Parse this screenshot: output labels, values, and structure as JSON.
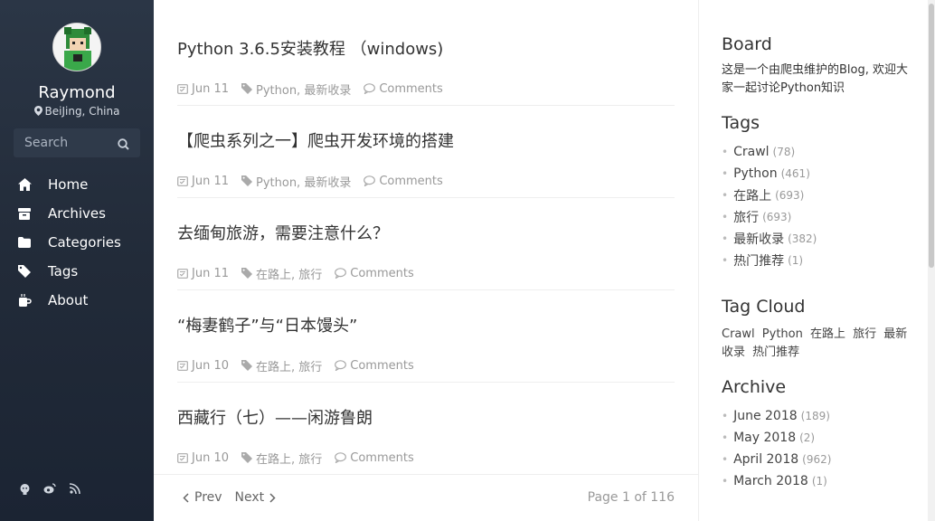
{
  "sidebar": {
    "author": "Raymond",
    "location": "BeiJing, China",
    "search_placeholder": "Search",
    "nav": [
      {
        "label": "Home",
        "icon": "home-icon"
      },
      {
        "label": "Archives",
        "icon": "archive-icon"
      },
      {
        "label": "Categories",
        "icon": "folder-icon"
      },
      {
        "label": "Tags",
        "icon": "tag-icon"
      },
      {
        "label": "About",
        "icon": "coffee-icon"
      }
    ],
    "social": [
      "github-icon",
      "weibo-icon",
      "rss-icon"
    ]
  },
  "posts": [
    {
      "title": "Python 3.6.5安装教程 （windows)",
      "date": "Jun 11",
      "tags": "Python, 最新收录",
      "comments": "Comments"
    },
    {
      "title": "【爬虫系列之一】爬虫开发环境的搭建",
      "date": "Jun 11",
      "tags": "Python, 最新收录",
      "comments": "Comments"
    },
    {
      "title": "去缅甸旅游，需要注意什么？",
      "date": "Jun 11",
      "tags": "在路上, 旅行",
      "comments": "Comments"
    },
    {
      "title": "“梅妻鹤子”与“日本馒头”",
      "date": "Jun 10",
      "tags": "在路上, 旅行",
      "comments": "Comments"
    },
    {
      "title": "西藏行（七）——闲游鲁朗",
      "date": "Jun 10",
      "tags": "在路上, 旅行",
      "comments": "Comments"
    }
  ],
  "pager": {
    "prev": "Prev",
    "next": "Next",
    "page_info": "Page 1 of 116"
  },
  "right": {
    "board_title": "Board",
    "board_text": "这是一个由爬虫维护的Blog, 欢迎大家一起讨论Python知识",
    "tags_title": "Tags",
    "tags": [
      {
        "name": "Crawl",
        "count": "(78)"
      },
      {
        "name": "Python",
        "count": "(461)"
      },
      {
        "name": "在路上",
        "count": "(693)"
      },
      {
        "name": "旅行",
        "count": "(693)"
      },
      {
        "name": "最新收录",
        "count": "(382)"
      },
      {
        "name": "热门推荐",
        "count": "(1)"
      }
    ],
    "cloud_title": "Tag Cloud",
    "cloud": [
      "Crawl",
      "Python",
      "在路上",
      "旅行",
      "最新收录",
      "热门推荐"
    ],
    "archive_title": "Archive",
    "archive": [
      {
        "name": "June 2018",
        "count": "(189)"
      },
      {
        "name": "May 2018",
        "count": "(2)"
      },
      {
        "name": "April 2018",
        "count": "(962)"
      },
      {
        "name": "March 2018",
        "count": "(1)"
      }
    ]
  }
}
